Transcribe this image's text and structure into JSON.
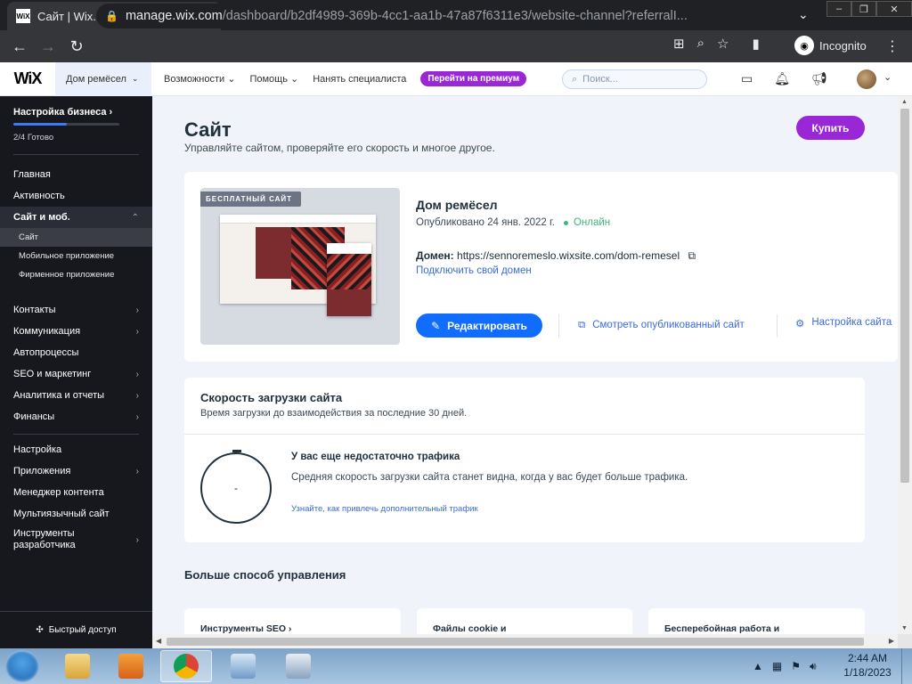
{
  "browser": {
    "tab_title": "Сайт | Wix.com",
    "favicon_text": "WiX",
    "tab_close": "✕",
    "new_tab": "+",
    "url_host": "manage.wix.com",
    "url_path": "/dashboard/b2df4989-369b-4cc1-aa1b-47a87f6311e3/website-channel?referralI...",
    "incognito_label": "Incognito"
  },
  "wix_header": {
    "logo": "WiX",
    "site_switch": "Дом ремёсел",
    "nav": [
      "Возможности",
      "Помощь",
      "Нанять специалиста"
    ],
    "premium_label": "Перейти на премиум",
    "search_placeholder": "Поиск..."
  },
  "sidebar": {
    "setup_title": "Настройка бизнеса",
    "progress_text": "2/4 Готово",
    "progress_fraction": 0.5,
    "group1": [
      {
        "label": "Главная"
      },
      {
        "label": "Активность"
      },
      {
        "label": "Сайт и моб."
      }
    ],
    "sub_items": [
      "Сайт",
      "Мобильное приложение",
      "Фирменное приложение"
    ],
    "group2": [
      "Контакты",
      "Коммуникация",
      "Автопроцессы",
      "SEO и маркетинг",
      "Аналитика и отчеты",
      "Финансы"
    ],
    "group3": [
      "Настройка",
      "Приложения",
      "Менеджер контента",
      "Мультиязычный сайт",
      "Инструменты разработчика"
    ],
    "quick_access": "Быстрый доступ"
  },
  "main": {
    "title": "Сайт",
    "subtitle": "Управляйте сайтом, проверяйте его скорость и многое другое.",
    "buy_label": "Купить",
    "site_card": {
      "badge": "БЕСПЛАТНЫЙ САЙТ",
      "name": "Дом ремёсел",
      "published": "Опубликовано 24 янв. 2022 г.",
      "status": "Онлайн",
      "domain_label": "Домен:",
      "domain_url": "https://sennoremeslo.wixsite.com/dom-remesel",
      "connect_domain": "Подключить свой домен",
      "edit_label": "Редактировать",
      "view_published": "Смотреть опубликованный сайт",
      "settings_label": "Настройка сайта"
    },
    "speed_card": {
      "title": "Скорость загрузки сайта",
      "subtitle": "Время загрузки до взаимодействия за последние 30 дней.",
      "gauge_value": "-",
      "no_traffic_title": "У вас еще недостаточно трафика",
      "no_traffic_text": "Средняя скорость загрузки сайта станет видна, когда у вас будет больше трафика.",
      "learn_link": "Узнайте, как привлечь дополнительный трафик"
    },
    "more_title": "Больше способ управления",
    "more_cards": [
      "Инструменты SEO",
      "Файлы cookie и",
      "Бесперебойная работа и"
    ]
  },
  "taskbar": {
    "time": "2:44 AM",
    "date": "1/18/2023"
  },
  "colors": {
    "wix_purple": "#9a27d5",
    "wix_blue": "#116dff",
    "sidebar_bg": "#17181d",
    "online_green": "#3db67a"
  }
}
